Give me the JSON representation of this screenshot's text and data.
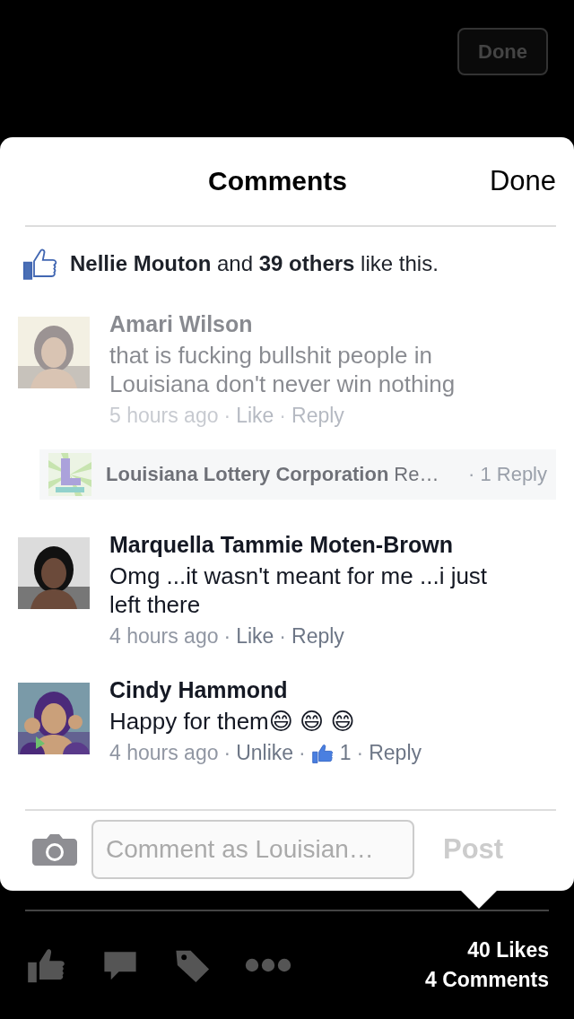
{
  "background": {
    "done_button": "Done",
    "likes_count": "40 Likes",
    "comments_count": "4 Comments"
  },
  "sheet": {
    "title": "Comments",
    "done": "Done",
    "likes_summary": "**Nellie Mouton** and **39 others** like this.",
    "comments": [
      {
        "name": "Amari Wilson",
        "text": "that is fucking bullshit people in Louisiana don't never win nothing",
        "time": "5 hours ago",
        "sep": "·",
        "like": "Like",
        "liked": false,
        "reply": "Reply",
        "dimmed": true,
        "reply_preview": {
          "name": "Louisiana Lottery Corporation",
          "snippet": "Re…",
          "sep": "·",
          "count": "1 Reply"
        }
      },
      {
        "name": "Marquella Tammie Moten-Brown",
        "text": "Omg ...it wasn't meant for me ...i just left there",
        "time": "4 hours ago",
        "sep": "·",
        "like": "Like",
        "liked": false,
        "reply": "Reply",
        "dimmed": false
      },
      {
        "name": "Cindy Hammond",
        "text": "Happy for them😄 😄 😄",
        "time": "4 hours ago",
        "sep": "·",
        "like": "Unlike",
        "liked": true,
        "like_count": "1",
        "reply": "Reply",
        "dimmed": false
      }
    ],
    "composer": {
      "placeholder": "Comment as Louisian…",
      "post": "Post",
      "disabled": true
    }
  }
}
